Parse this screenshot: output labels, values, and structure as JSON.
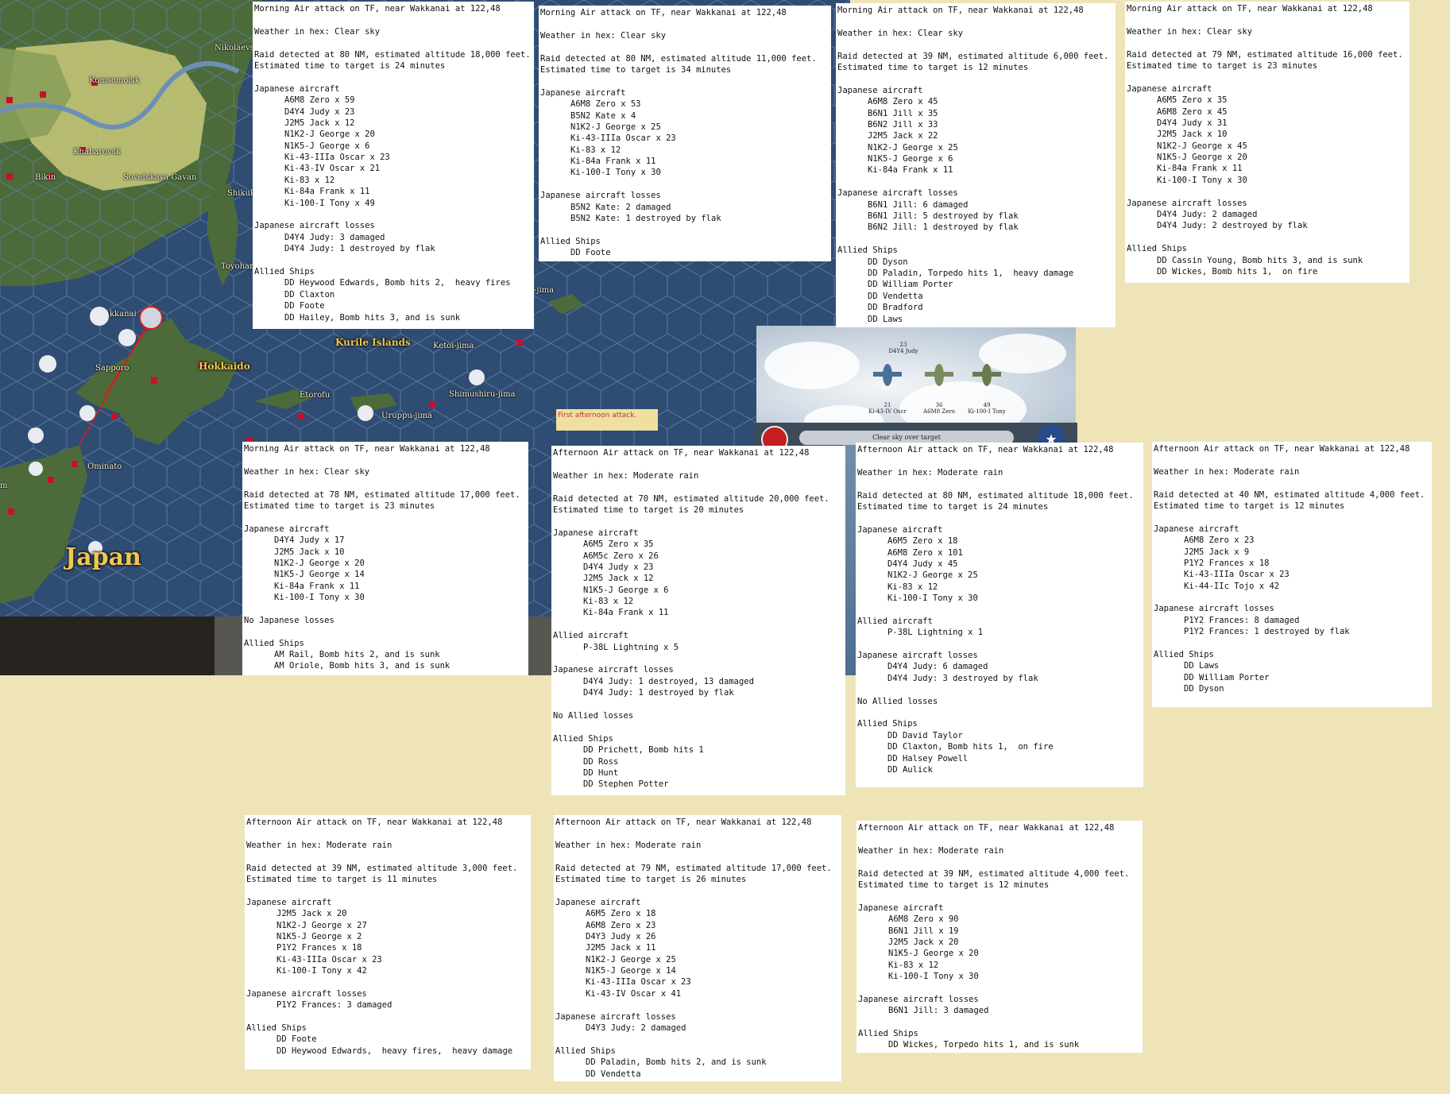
{
  "map": {
    "regions": {
      "japan": "Japan",
      "hokkaido": "Hokkaido",
      "kurile": "Kurile Islands"
    },
    "cities": {
      "nikolaevsk": "Nikolaevsk",
      "komsomolsk": "Komsomolsk",
      "khabarovsk": "Khabarovsk",
      "bikin": "Bikin",
      "sovetskaya": "Sovetskaya Gavan",
      "shikuka": "Shikuk",
      "toyohara": "Toyohar",
      "wakkanai": "kkanai",
      "sapporo": "Sapporo",
      "etorofu": "Etorofu",
      "ketoi": "Ketoi-jima",
      "shimushiru": "Shimushiru-jima",
      "uruppu": "Uruppu-jima",
      "ominato": "Ominato",
      "jima": "-jima",
      "edge_m": "m"
    },
    "colors": {
      "sea": "#2f4c73",
      "land": "#4d6b3a",
      "highlight_land": "#c9c97a",
      "base_marker": "#c8102e",
      "strike_line": "#d02020"
    }
  },
  "combat_panel": {
    "planes": [
      {
        "label": "Ki-43-IV Oscr",
        "count": "21"
      },
      {
        "label": "A6M8 Zero",
        "count": "36"
      },
      {
        "label": "Ki-100-I Tony",
        "count": "49"
      }
    ],
    "enemy_label": "D4Y4 Judy",
    "enemy_count": "23",
    "status": "Clear sky over target"
  },
  "afternoon_marker": "First afternoon attack.",
  "reports": [
    {
      "id": "r1",
      "lines": [
        "Morning Air attack on TF, near Wakkanai at 122,48",
        "",
        "Weather in hex: Clear sky",
        "",
        "Raid detected at 80 NM, estimated altitude 18,000 feet.",
        "Estimated time to target is 24 minutes",
        "",
        "Japanese aircraft",
        "   A6M8 Zero x 59",
        "   D4Y4 Judy x 23",
        "   J2M5 Jack x 12",
        "   N1K2-J George x 20",
        "   N1K5-J George x 6",
        "   Ki-43-IIIa Oscar x 23",
        "   Ki-43-IV Oscar x 21",
        "   Ki-83 x 12",
        "   Ki-84a Frank x 11",
        "   Ki-100-I Tony x 49",
        "",
        "Japanese aircraft losses",
        "   D4Y4 Judy: 3 damaged",
        "   D4Y4 Judy: 1 destroyed by flak",
        "",
        "Allied Ships",
        "   DD Heywood Edwards, Bomb hits 2,  heavy fires",
        "   DD Claxton",
        "   DD Foote",
        "   DD Hailey, Bomb hits 3, and is sunk"
      ]
    },
    {
      "id": "r2",
      "lines": [
        "Morning Air attack on TF, near Wakkanai at 122,48",
        "",
        "Weather in hex: Clear sky",
        "",
        "Raid detected at 80 NM, estimated altitude 11,000 feet.",
        "Estimated time to target is 34 minutes",
        "",
        "Japanese aircraft",
        "   A6M8 Zero x 53",
        "   B5N2 Kate x 4",
        "   N1K2-J George x 25",
        "   Ki-43-IIIa Oscar x 23",
        "   Ki-83 x 12",
        "   Ki-84a Frank x 11",
        "   Ki-100-I Tony x 30",
        "",
        "Japanese aircraft losses",
        "   B5N2 Kate: 2 damaged",
        "   B5N2 Kate: 1 destroyed by flak",
        "",
        "Allied Ships",
        "   DD Foote"
      ]
    },
    {
      "id": "r3",
      "lines": [
        "Morning Air attack on TF, near Wakkanai at 122,48",
        "",
        "Weather in hex: Clear sky",
        "",
        "Raid detected at 39 NM, estimated altitude 6,000 feet.",
        "Estimated time to target is 12 minutes",
        "",
        "Japanese aircraft",
        "   A6M8 Zero x 45",
        "   B6N1 Jill x 35",
        "   B6N2 Jill x 33",
        "   J2M5 Jack x 22",
        "   N1K2-J George x 25",
        "   N1K5-J George x 6",
        "   Ki-84a Frank x 11",
        "",
        "Japanese aircraft losses",
        "   B6N1 Jill: 6 damaged",
        "   B6N1 Jill: 5 destroyed by flak",
        "   B6N2 Jill: 1 destroyed by flak",
        "",
        "Allied Ships",
        "   DD Dyson",
        "   DD Paladin, Torpedo hits 1,  heavy damage",
        "   DD William Porter",
        "   DD Vendetta",
        "   DD Bradford",
        "   DD Laws"
      ]
    },
    {
      "id": "r4",
      "lines": [
        "Morning Air attack on TF, near Wakkanai at 122,48",
        "",
        "Weather in hex: Clear sky",
        "",
        "Raid detected at 79 NM, estimated altitude 16,000 feet.",
        "Estimated time to target is 23 minutes",
        "",
        "Japanese aircraft",
        "   A6M5 Zero x 35",
        "   A6M8 Zero x 45",
        "   D4Y4 Judy x 31",
        "   J2M5 Jack x 10",
        "   N1K2-J George x 45",
        "   N1K5-J George x 20",
        "   Ki-84a Frank x 11",
        "   Ki-100-I Tony x 30",
        "",
        "Japanese aircraft losses",
        "   D4Y4 Judy: 2 damaged",
        "   D4Y4 Judy: 2 destroyed by flak",
        "",
        "Allied Ships",
        "   DD Cassin Young, Bomb hits 3, and is sunk",
        "   DD Wickes, Bomb hits 1,  on fire"
      ]
    },
    {
      "id": "r5",
      "lines": [
        "Morning Air attack on TF, near Wakkanai at 122,48",
        "",
        "Weather in hex: Clear sky",
        "",
        "Raid detected at 78 NM, estimated altitude 17,000 feet.",
        "Estimated time to target is 23 minutes",
        "",
        "Japanese aircraft",
        "   D4Y4 Judy x 17",
        "   J2M5 Jack x 10",
        "   N1K2-J George x 20",
        "   N1K5-J George x 14",
        "   Ki-84a Frank x 11",
        "   Ki-100-I Tony x 30",
        "",
        "No Japanese losses",
        "",
        "Allied Ships",
        "   AM Rail, Bomb hits 2, and is sunk",
        "   AM Oriole, Bomb hits 3, and is sunk"
      ]
    },
    {
      "id": "r6",
      "lines": [
        "Afternoon Air attack on TF, near Wakkanai at 122,48",
        "",
        "Weather in hex: Moderate rain",
        "",
        "Raid detected at 70 NM, estimated altitude 20,000 feet.",
        "Estimated time to target is 20 minutes",
        "",
        "Japanese aircraft",
        "   A6M5 Zero x 35",
        "   A6M5c Zero x 26",
        "   D4Y4 Judy x 23",
        "   J2M5 Jack x 12",
        "   N1K5-J George x 6",
        "   Ki-83 x 12",
        "   Ki-84a Frank x 11",
        "",
        "Allied aircraft",
        "   P-38L Lightning x 5",
        "",
        "Japanese aircraft losses",
        "   D4Y4 Judy: 1 destroyed, 13 damaged",
        "   D4Y4 Judy: 1 destroyed by flak",
        "",
        "No Allied losses",
        "",
        "Allied Ships",
        "   DD Prichett, Bomb hits 1",
        "   DD Ross",
        "   DD Hunt",
        "   DD Stephen Potter"
      ]
    },
    {
      "id": "r7",
      "lines": [
        "Afternoon Air attack on TF, near Wakkanai at 122,48",
        "",
        "Weather in hex: Moderate rain",
        "",
        "Raid detected at 80 NM, estimated altitude 18,000 feet.",
        "Estimated time to target is 24 minutes",
        "",
        "Japanese aircraft",
        "   A6M5 Zero x 18",
        "   A6M8 Zero x 101",
        "   D4Y4 Judy x 45",
        "   N1K2-J George x 25",
        "   Ki-83 x 12",
        "   Ki-100-I Tony x 30",
        "",
        "Allied aircraft",
        "   P-38L Lightning x 1",
        "",
        "Japanese aircraft losses",
        "   D4Y4 Judy: 6 damaged",
        "   D4Y4 Judy: 3 destroyed by flak",
        "",
        "No Allied losses",
        "",
        "Allied Ships",
        "   DD David Taylor",
        "   DD Claxton, Bomb hits 1,  on fire",
        "   DD Halsey Powell",
        "   DD Aulick"
      ]
    },
    {
      "id": "r8",
      "lines": [
        "Afternoon Air attack on TF, near Wakkanai at 122,48",
        "",
        "Weather in hex: Moderate rain",
        "",
        "Raid detected at 40 NM, estimated altitude 4,000 feet.",
        "Estimated time to target is 12 minutes",
        "",
        "Japanese aircraft",
        "   A6M8 Zero x 23",
        "   J2M5 Jack x 9",
        "   P1Y2 Frances x 18",
        "   Ki-43-IIIa Oscar x 23",
        "   Ki-44-IIc Tojo x 42",
        "",
        "Japanese aircraft losses",
        "   P1Y2 Frances: 8 damaged",
        "   P1Y2 Frances: 1 destroyed by flak",
        "",
        "Allied Ships",
        "   DD Laws",
        "   DD William Porter",
        "   DD Dyson"
      ]
    },
    {
      "id": "r9",
      "lines": [
        "Afternoon Air attack on TF, near Wakkanai at 122,48",
        "",
        "Weather in hex: Moderate rain",
        "",
        "Raid detected at 39 NM, estimated altitude 3,000 feet.",
        "Estimated time to target is 11 minutes",
        "",
        "Japanese aircraft",
        "   J2M5 Jack x 20",
        "   N1K2-J George x 27",
        "   N1K5-J George x 2",
        "   P1Y2 Frances x 18",
        "   Ki-43-IIIa Oscar x 23",
        "   Ki-100-I Tony x 42",
        "",
        "Japanese aircraft losses",
        "   P1Y2 Frances: 3 damaged",
        "",
        "Allied Ships",
        "   DD Foote",
        "   DD Heywood Edwards,  heavy fires,  heavy damage"
      ]
    },
    {
      "id": "r10",
      "lines": [
        "Afternoon Air attack on TF, near Wakkanai at 122,48",
        "",
        "Weather in hex: Moderate rain",
        "",
        "Raid detected at 79 NM, estimated altitude 17,000 feet.",
        "Estimated time to target is 26 minutes",
        "",
        "Japanese aircraft",
        "   A6M5 Zero x 18",
        "   A6M8 Zero x 23",
        "   D4Y3 Judy x 26",
        "   J2M5 Jack x 11",
        "   N1K2-J George x 25",
        "   N1K5-J George x 14",
        "   Ki-43-IIIa Oscar x 23",
        "   Ki-43-IV Oscar x 41",
        "",
        "Japanese aircraft losses",
        "   D4Y3 Judy: 2 damaged",
        "",
        "Allied Ships",
        "   DD Paladin, Bomb hits 2, and is sunk",
        "   DD Vendetta"
      ]
    },
    {
      "id": "r11",
      "lines": [
        "Afternoon Air attack on TF, near Wakkanai at 122,48",
        "",
        "Weather in hex: Moderate rain",
        "",
        "Raid detected at 39 NM, estimated altitude 4,000 feet.",
        "Estimated time to target is 12 minutes",
        "",
        "Japanese aircraft",
        "   A6M8 Zero x 90",
        "   B6N1 Jill x 19",
        "   J2M5 Jack x 20",
        "   N1K5-J George x 20",
        "   Ki-83 x 12",
        "   Ki-100-I Tony x 30",
        "",
        "Japanese aircraft losses",
        "   B6N1 Jill: 3 damaged",
        "",
        "Allied Ships",
        "   DD Wickes, Torpedo hits 1, and is sunk"
      ]
    }
  ]
}
